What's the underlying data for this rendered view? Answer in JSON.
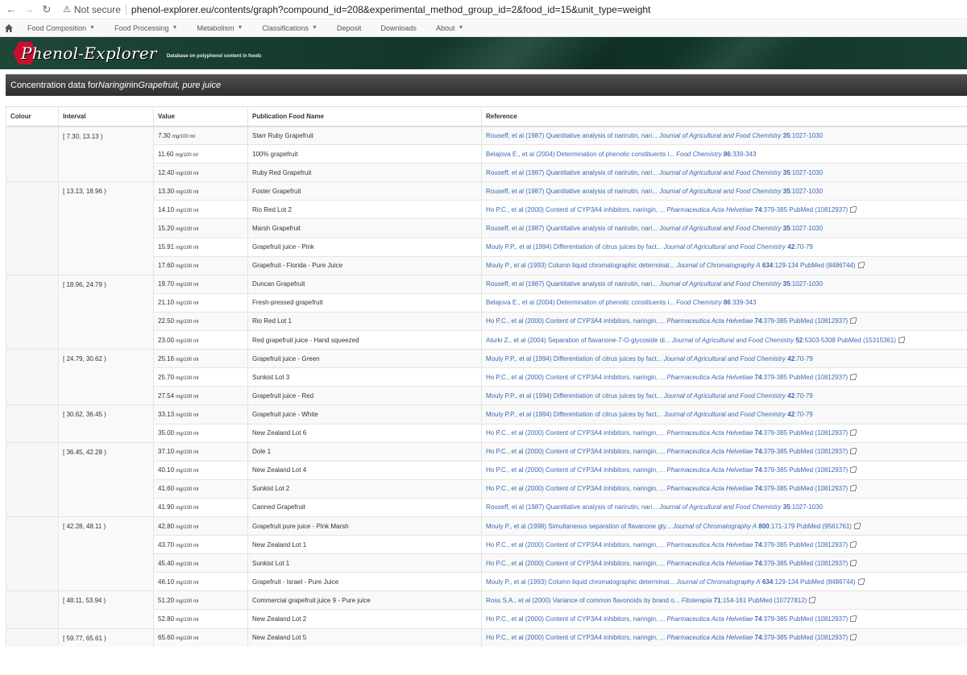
{
  "browser": {
    "not_secure": "Not secure",
    "url": "phenol-explorer.eu/contents/graph?compound_id=208&experimental_method_group_id=2&food_id=15&unit_type=weight"
  },
  "menu": [
    {
      "label": "Food Composition",
      "dropdown": true
    },
    {
      "label": "Food Processing",
      "dropdown": true
    },
    {
      "label": "Metabolism",
      "dropdown": true
    },
    {
      "label": "Classifications",
      "dropdown": true
    },
    {
      "label": "Deposit",
      "dropdown": false
    },
    {
      "label": "Downloads",
      "dropdown": false
    },
    {
      "label": "About",
      "dropdown": true
    }
  ],
  "banner": {
    "logo_text": "Phenol-Explorer",
    "tagline": "Database on polyphenol content in foods"
  },
  "title": {
    "prefix": "Concentration data for ",
    "compound": "Naringin",
    "middle": " in ",
    "food": "Grapefruit, pure juice"
  },
  "table": {
    "headers": [
      "Colour",
      "Interval",
      "Value",
      "Publication Food Name",
      "Reference"
    ],
    "unit": "mg/100 ml",
    "groups": [
      {
        "interval": "[ 7.30, 13.13 )",
        "rows": [
          {
            "value": "7.30",
            "food": "Starr Ruby Grapefruit",
            "ref": "Rouseff, et al (1987) Quantitative analysis of narirutin, nari... ",
            "journal": "Journal of Agricultural and Food Chemistry",
            "vol": "35",
            "pages": ":1027-1030",
            "pubmed": ""
          },
          {
            "value": "11.60",
            "food": "100% grapefruit",
            "ref": "Belajova E., et al (2004) Determination of phenolic constituents i... ",
            "journal": "Food Chemistry",
            "vol": "86",
            "pages": ":339-343",
            "pubmed": ""
          },
          {
            "value": "12.40",
            "food": "Ruby Red Grapefruit",
            "ref": "Rouseff, et al (1987) Quantitative analysis of narirutin, nari... ",
            "journal": "Journal of Agricultural and Food Chemistry",
            "vol": "35",
            "pages": ":1027-1030",
            "pubmed": ""
          }
        ]
      },
      {
        "interval": "[ 13.13, 18.96 )",
        "rows": [
          {
            "value": "13.30",
            "food": "Foster Grapefruit",
            "ref": "Rouseff, et al (1987) Quantitative analysis of narirutin, nari... ",
            "journal": "Journal of Agricultural and Food Chemistry",
            "vol": "35",
            "pages": ":1027-1030",
            "pubmed": ""
          },
          {
            "value": "14.10",
            "food": "Rio Red Lot 2",
            "ref": "Ho P.C., et al (2000) Content of CYP3A4 inhibitors, naringin, ... ",
            "journal": "Pharmaceutica Acta Helvetiae",
            "vol": "74",
            "pages": ":379-385",
            "pubmed": " PubMed (10812937)"
          },
          {
            "value": "15.20",
            "food": "Marsh Grapefruit",
            "ref": "Rouseff, et al (1987) Quantitative analysis of narirutin, nari... ",
            "journal": "Journal of Agricultural and Food Chemistry",
            "vol": "35",
            "pages": ":1027-1030",
            "pubmed": ""
          },
          {
            "value": "15.91",
            "food": "Grapefruit juice - Pink",
            "ref": "Mouly P.P., et al (1994) Differentiation of citrus juices by fact... ",
            "journal": "Journal of Agricultural and Food Chemistry",
            "vol": "42",
            "pages": ":70-79",
            "pubmed": ""
          },
          {
            "value": "17.60",
            "food": "Grapefruit - Florida - Pure Juice",
            "ref": "Mouly P., et al (1993) Column liquid chromatographic determinat... ",
            "journal": "Journal of Chromatography A",
            "vol": "634",
            "pages": ":129-134",
            "pubmed": " PubMed (8486744)"
          }
        ]
      },
      {
        "interval": "[ 18.96, 24.79 )",
        "rows": [
          {
            "value": "19.70",
            "food": "Duncan Grapefruit",
            "ref": "Rouseff, et al (1987) Quantitative analysis of narirutin, nari... ",
            "journal": "Journal of Agricultural and Food Chemistry",
            "vol": "35",
            "pages": ":1027-1030",
            "pubmed": ""
          },
          {
            "value": "21.10",
            "food": "Fresh-pressed grapefruit",
            "ref": "Belajova E., et al (2004) Determination of phenolic constituents i... ",
            "journal": "Food Chemistry",
            "vol": "86",
            "pages": ":339-343",
            "pubmed": ""
          },
          {
            "value": "22.50",
            "food": "Rio Red Lot 1",
            "ref": "Ho P.C., et al (2000) Content of CYP3A4 inhibitors, naringin, ... ",
            "journal": "Pharmaceutica Acta Helvetiae",
            "vol": "74",
            "pages": ":379-385",
            "pubmed": " PubMed (10812937)"
          },
          {
            "value": "23.00",
            "food": "Red grapefruit juice - Hand squeezed",
            "ref": "Aturki Z., et al (2004) Separation of flavanone-7-O-glycoside di... ",
            "journal": "Journal of Agricultural and Food Chemistry",
            "vol": "52",
            "pages": ":5303-5308",
            "pubmed": " PubMed (15315361)"
          }
        ]
      },
      {
        "interval": "[ 24.79, 30.62 )",
        "rows": [
          {
            "value": "25.16",
            "food": "Grapefruit juice - Green",
            "ref": "Mouly P.P., et al (1994) Differentiation of citrus juices by fact... ",
            "journal": "Journal of Agricultural and Food Chemistry",
            "vol": "42",
            "pages": ":70-79",
            "pubmed": ""
          },
          {
            "value": "25.70",
            "food": "Sunkist Lot 3",
            "ref": "Ho P.C., et al (2000) Content of CYP3A4 inhibitors, naringin, ... ",
            "journal": "Pharmaceutica Acta Helvetiae",
            "vol": "74",
            "pages": ":379-385",
            "pubmed": " PubMed (10812937)"
          },
          {
            "value": "27.54",
            "food": "Grapefruit juice - Red",
            "ref": "Mouly P.P., et al (1994) Differentiation of citrus juices by fact... ",
            "journal": "Journal of Agricultural and Food Chemistry",
            "vol": "42",
            "pages": ":70-79",
            "pubmed": ""
          }
        ]
      },
      {
        "interval": "[ 30.62, 36.45 )",
        "rows": [
          {
            "value": "33.13",
            "food": "Grapefruit juice - White",
            "ref": "Mouly P.P., et al (1994) Differentiation of citrus juices by fact... ",
            "journal": "Journal of Agricultural and Food Chemistry",
            "vol": "42",
            "pages": ":70-79",
            "pubmed": ""
          },
          {
            "value": "35.00",
            "food": "New Zealand Lot 6",
            "ref": "Ho P.C., et al (2000) Content of CYP3A4 inhibitors, naringin, ... ",
            "journal": "Pharmaceutica Acta Helvetiae",
            "vol": "74",
            "pages": ":379-385",
            "pubmed": " PubMed (10812937)"
          }
        ]
      },
      {
        "interval": "[ 36.45, 42.28 )",
        "rows": [
          {
            "value": "37.10",
            "food": "Dole 1",
            "ref": "Ho P.C., et al (2000) Content of CYP3A4 inhibitors, naringin, ... ",
            "journal": "Pharmaceutica Acta Helvetiae",
            "vol": "74",
            "pages": ":379-385",
            "pubmed": " PubMed (10812937)"
          },
          {
            "value": "40.10",
            "food": "New Zealand Lot 4",
            "ref": "Ho P.C., et al (2000) Content of CYP3A4 inhibitors, naringin, ... ",
            "journal": "Pharmaceutica Acta Helvetiae",
            "vol": "74",
            "pages": ":379-385",
            "pubmed": " PubMed (10812937)"
          },
          {
            "value": "41.60",
            "food": "Sunkist Lot 2",
            "ref": "Ho P.C., et al (2000) Content of CYP3A4 inhibitors, naringin, ... ",
            "journal": "Pharmaceutica Acta Helvetiae",
            "vol": "74",
            "pages": ":379-385",
            "pubmed": " PubMed (10812937)"
          },
          {
            "value": "41.90",
            "food": "Canned Grapefruit",
            "ref": "Rouseff, et al (1987) Quantitative analysis of narirutin, nari... ",
            "journal": "Journal of Agricultural and Food Chemistry",
            "vol": "35",
            "pages": ":1027-1030",
            "pubmed": ""
          }
        ]
      },
      {
        "interval": "[ 42.28, 48.11 )",
        "rows": [
          {
            "value": "42.80",
            "food": "Grapefruit pure juice - Pink Marsh",
            "ref": "Mouly P., et al (1998) Simultaneous separation of flavanone gly... ",
            "journal": "Journal of Chromatography A",
            "vol": "800",
            "pages": ":171-179",
            "pubmed": " PubMed (9561761)"
          },
          {
            "value": "43.70",
            "food": "New Zealand Lot 1",
            "ref": "Ho P.C., et al (2000) Content of CYP3A4 inhibitors, naringin, ... ",
            "journal": "Pharmaceutica Acta Helvetiae",
            "vol": "74",
            "pages": ":379-385",
            "pubmed": " PubMed (10812937)"
          },
          {
            "value": "45.40",
            "food": "Sunkist Lot 1",
            "ref": "Ho P.C., et al (2000) Content of CYP3A4 inhibitors, naringin, ... ",
            "journal": "Pharmaceutica Acta Helvetiae",
            "vol": "74",
            "pages": ":379-385",
            "pubmed": " PubMed (10812937)"
          },
          {
            "value": "46.10",
            "food": "Grapefruit - Israel - Pure Juice",
            "ref": "Mouly P., et al (1993) Column liquid chromatographic determinat... ",
            "journal": "Journal of Chromatography A",
            "vol": "634",
            "pages": ":129-134",
            "pubmed": " PubMed (8486744)"
          }
        ]
      },
      {
        "interval": "[ 48.11, 53.94 )",
        "rows": [
          {
            "value": "51.20",
            "food": "Commercial grapefruit juice 9 - Pure juice",
            "ref": "Ross S.A., et al (2000) Variance of common flavonoids by brand o... ",
            "journal": "Fitoterapia",
            "vol": "71",
            "pages": ":154-161",
            "pubmed": " PubMed (10727812)"
          },
          {
            "value": "52.80",
            "food": "New Zealand Lot 2",
            "ref": "Ho P.C., et al (2000) Content of CYP3A4 inhibitors, naringin, ... ",
            "journal": "Pharmaceutica Acta Helvetiae",
            "vol": "74",
            "pages": ":379-385",
            "pubmed": " PubMed (10812937)"
          }
        ]
      },
      {
        "interval": "[ 59.77, 65.61 )",
        "rows": [
          {
            "value": "65.60",
            "food": "New Zealand Lot 5",
            "ref": "Ho P.C., et al (2000) Content of CYP3A4 inhibitors, naringin, ... ",
            "journal": "Pharmaceutica Acta Helvetiae",
            "vol": "74",
            "pages": ":379-385",
            "pubmed": " PubMed (10812937)"
          }
        ]
      }
    ]
  }
}
